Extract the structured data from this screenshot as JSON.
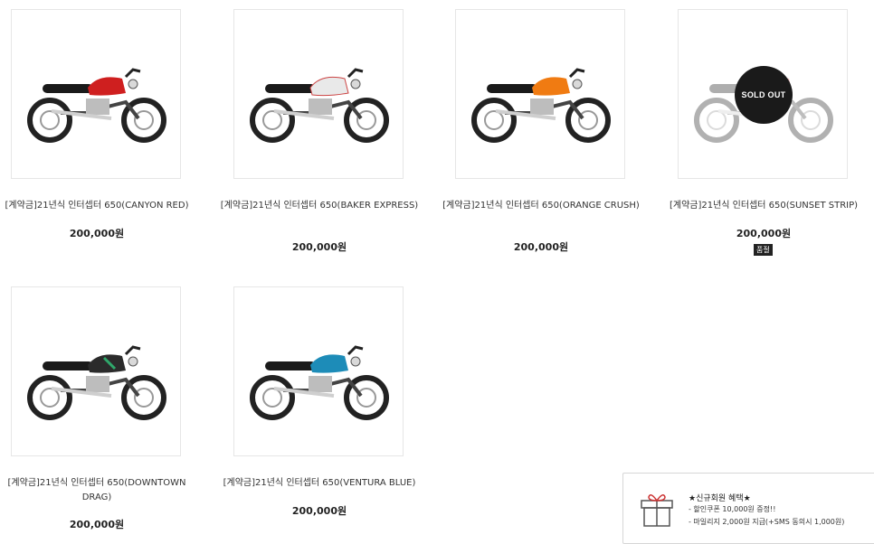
{
  "products": [
    {
      "name": "[계약금]21년식 인터셉터 650(CANYON RED)",
      "price": "200,000원",
      "tank_color": "#cf1f1f",
      "sold_out": false
    },
    {
      "name": "[계약금]21년식 인터셉터 650(BAKER EXPRESS)",
      "price": "200,000원",
      "tank_color": "#e9e9e9",
      "sold_out": false
    },
    {
      "name": "[계약금]21년식 인터셉터 650(ORANGE CRUSH)",
      "price": "200,000원",
      "tank_color": "#f07b12",
      "sold_out": false
    },
    {
      "name": "[계약금]21년식 인터셉터 650(SUNSET STRIP)",
      "price": "200,000원",
      "tank_color": "#c33030",
      "sold_out": true,
      "sold_out_label": "SOLD OUT",
      "tag": "품절"
    },
    {
      "name": "[계약금]21년식 인터셉터 650(DOWNTOWN DRAG)",
      "price": "200,000원",
      "tank_color": "#2b2b2b",
      "sold_out": false
    },
    {
      "name": "[계약금]21년식 인터셉터 650(VENTURA BLUE)",
      "price": "200,000원",
      "tank_color": "#1d8cb8",
      "sold_out": false
    }
  ],
  "popup": {
    "title": "★신규회원 혜택★",
    "line1": "- 할인쿠폰 10,000원 증정!!",
    "line2": "- 마일리지 2,000원 지급(+SMS 동의시 1,000원)",
    "icon": "gift-icon"
  }
}
